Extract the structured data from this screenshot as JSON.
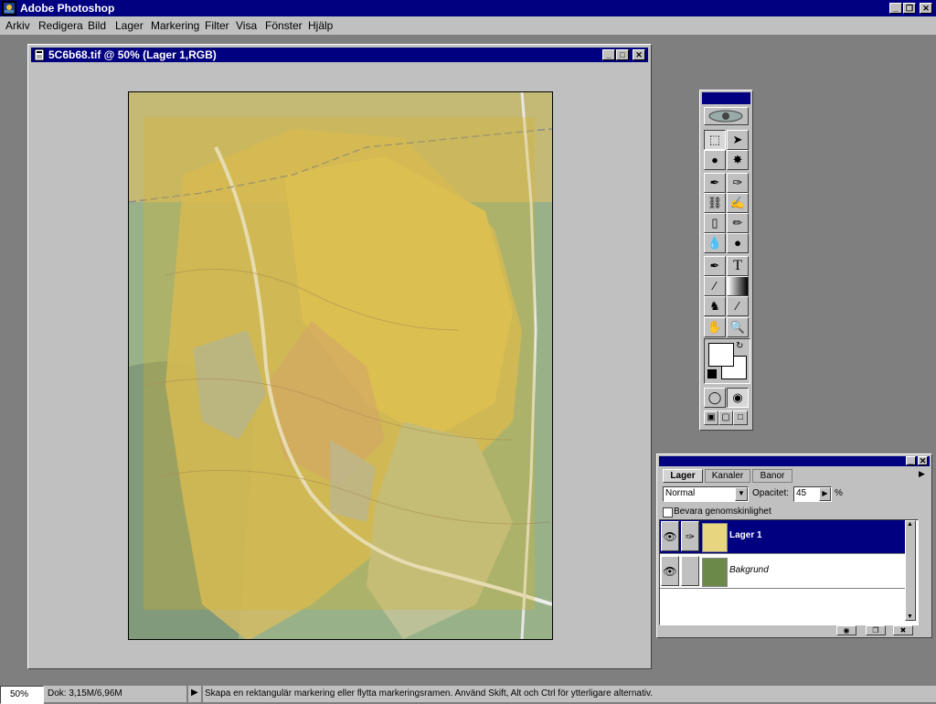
{
  "app": {
    "title": "Adobe Photoshop"
  },
  "menu": [
    "Arkiv",
    "Redigera",
    "Bild",
    "Lager",
    "Markering",
    "Filter",
    "Visa",
    "Fönster",
    "Hjälp"
  ],
  "document": {
    "title": "5C6b68.tif @ 50% (Lager 1,RGB)"
  },
  "layers_panel": {
    "tabs": [
      "Lager",
      "Kanaler",
      "Banor"
    ],
    "blend_mode": "Normal",
    "opacity_label": "Opacitet:",
    "opacity_value": "45",
    "opacity_unit": "%",
    "preserve_label": "Bevara genomskinlighet",
    "layers": [
      {
        "name": "Lager 1",
        "selected": true
      },
      {
        "name": "Bakgrund",
        "selected": false
      }
    ]
  },
  "status": {
    "zoom": "50%",
    "doc_size": "Dok: 3,15M/6,96M",
    "hint": "Skapa en rektangulär markering eller flytta markeringsramen. Använd Skift, Alt och Ctrl för ytterligare alternativ."
  },
  "colors": {
    "title_bar": "#000080",
    "chrome": "#c0c0c0",
    "desktop": "#7f7f7f",
    "map_overlay": "#e6cf6e"
  },
  "icons": [
    "photoshop-app-icon",
    "document-icon",
    "eye-icon",
    "brush-icon",
    "marquee-icon",
    "move-icon",
    "lasso-icon",
    "magic-wand-icon",
    "airbrush-icon",
    "paintbrush-icon",
    "rubber-stamp-icon",
    "smudge-icon",
    "eraser-icon",
    "pencil-icon",
    "blur-icon",
    "dodge-icon",
    "pen-icon",
    "type-icon",
    "line-icon",
    "gradient-icon",
    "paint-bucket-icon",
    "eyedropper-icon",
    "hand-icon",
    "zoom-icon"
  ]
}
